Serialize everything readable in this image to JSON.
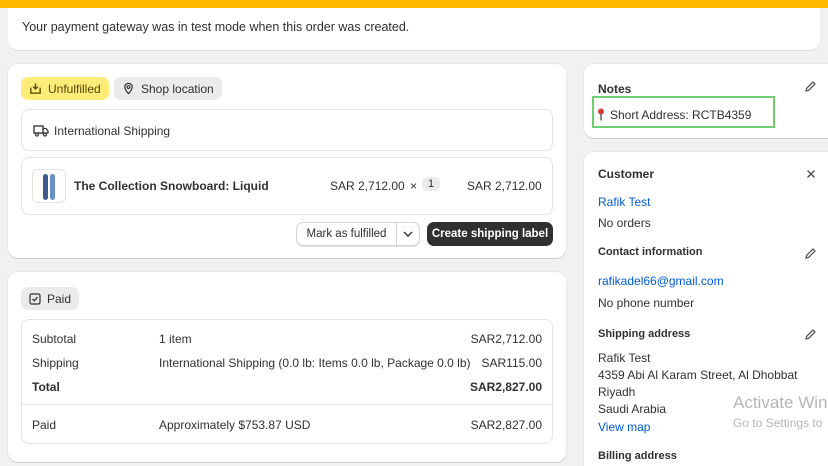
{
  "banner": {
    "text": "Your payment gateway was in test mode when this order was created."
  },
  "fulfillment": {
    "status_badge": "Unfulfilled",
    "location_badge": "Shop location",
    "shipping_method": "International Shipping",
    "item": {
      "name": "The Collection Snowboard: Liquid",
      "unit_price": "SAR 2,712.00",
      "multiply": "×",
      "quantity": "1",
      "total": "SAR 2,712.00"
    },
    "mark_fulfilled_label": "Mark as fulfilled",
    "create_label_label": "Create shipping label"
  },
  "payment": {
    "status_badge": "Paid",
    "rows": [
      {
        "label": "Subtotal",
        "detail": "1 item",
        "amount": "SAR2,712.00"
      },
      {
        "label": "Shipping",
        "detail": "International Shipping (0.0 lb: Items 0.0 lb, Package 0.0 lb)",
        "amount": "SAR115.00"
      },
      {
        "label": "Total",
        "detail": "",
        "amount": "SAR2,827.00"
      }
    ],
    "paid": {
      "label": "Paid",
      "detail": "Approximately $753.87 USD",
      "amount": "SAR2,827.00"
    }
  },
  "notes": {
    "title": "Notes",
    "text": "Short Address: RCTB4359",
    "highlight_color": "#6fcf6f"
  },
  "customer": {
    "title": "Customer",
    "name": "Rafik Test",
    "orders": "No orders",
    "contact_title": "Contact information",
    "email": "rafikadel66@gmail.com",
    "phone": "No phone number",
    "shipping_title": "Shipping address",
    "address": [
      "Rafik Test",
      "4359 Abi Al Karam Street, Al Dhobbat",
      "Riyadh",
      "Saudi Arabia"
    ],
    "view_map": "View map",
    "billing_title": "Billing address"
  },
  "watermark": {
    "line1": "Activate Win",
    "line2": "Go to Settings to"
  },
  "colors": {
    "topbar": "#ffb800",
    "unfulfilled_badge": "#ffeb78",
    "link": "#005bd3",
    "primary_button": "#303030"
  }
}
